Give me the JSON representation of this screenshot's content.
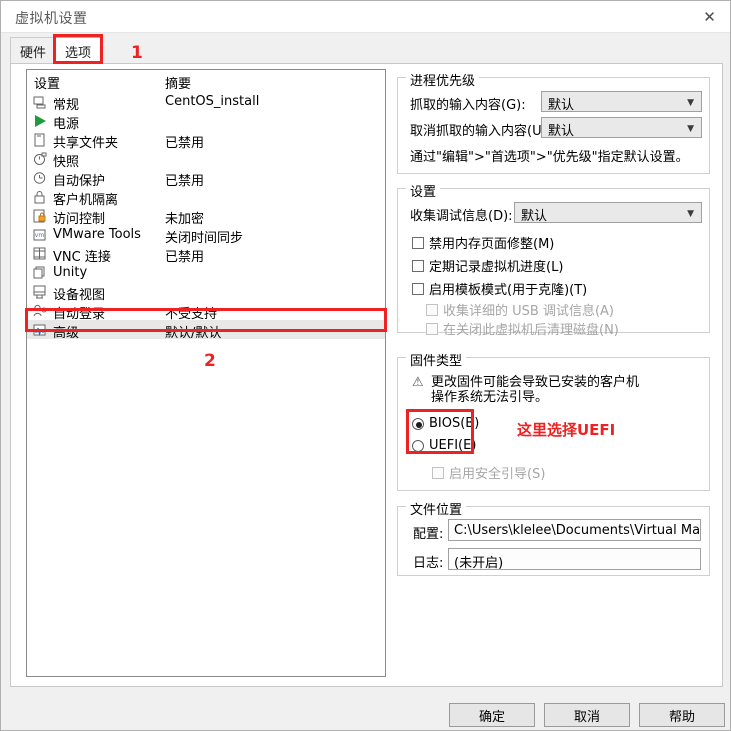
{
  "window": {
    "title": "虚拟机设置",
    "close_label": "✕"
  },
  "tabs": [
    {
      "label": "硬件",
      "active": false
    },
    {
      "label": "选项",
      "active": true
    }
  ],
  "settings_list": {
    "headers": {
      "name": "设置",
      "summary": "摘要"
    },
    "rows": [
      {
        "icon": "monitor-icon",
        "label": "常规",
        "summary": "CentOS_install",
        "selected": false
      },
      {
        "icon": "power-play-icon",
        "label": "电源",
        "summary": "",
        "selected": false
      },
      {
        "icon": "folder-share-icon",
        "label": "共享文件夹",
        "summary": "已禁用",
        "selected": false
      },
      {
        "icon": "camera-icon",
        "label": "快照",
        "summary": "",
        "selected": false
      },
      {
        "icon": "clock-icon",
        "label": "自动保护",
        "summary": "已禁用",
        "selected": false
      },
      {
        "icon": "lock-icon",
        "label": "客户机隔离",
        "summary": "",
        "selected": false
      },
      {
        "icon": "access-lock-icon",
        "label": "访问控制",
        "summary": "未加密",
        "selected": false
      },
      {
        "icon": "vmware-tools-icon",
        "label": "VMware Tools",
        "summary": "关闭时间同步",
        "selected": false
      },
      {
        "icon": "vnc-icon",
        "label": "VNC 连接",
        "summary": "已禁用",
        "selected": false
      },
      {
        "icon": "unity-icon",
        "label": "Unity",
        "summary": "",
        "selected": false
      },
      {
        "icon": "device-view-icon",
        "label": "设备视图",
        "summary": "",
        "selected": false
      },
      {
        "icon": "user-auto-icon",
        "label": "自动登录",
        "summary": "不受支持",
        "selected": false
      },
      {
        "icon": "advanced-icon",
        "label": "高级",
        "summary": "默认/默认",
        "selected": true
      }
    ]
  },
  "priority_group": {
    "legend": "进程优先级",
    "grab_label": "抓取的输入内容(G):",
    "grab_value": "默认",
    "ungrab_label": "取消抓取的输入内容(U):",
    "ungrab_value": "默认",
    "hint": "通过\"编辑\">\"首选项\">\"优先级\"指定默认设置。"
  },
  "settings_group": {
    "legend": "设置",
    "debug_label": "收集调试信息(D):",
    "debug_value": "默认",
    "checkboxes": [
      {
        "label": "禁用内存页面修整(M)",
        "checked": false,
        "disabled": false
      },
      {
        "label": "定期记录虚拟机进度(L)",
        "checked": false,
        "disabled": false
      },
      {
        "label": "启用模板模式(用于克隆)(T)",
        "checked": false,
        "disabled": false
      },
      {
        "label": "收集详细的 USB 调试信息(A)",
        "checked": false,
        "disabled": true
      },
      {
        "label": "在关闭此虚拟机后清理磁盘(N)",
        "checked": false,
        "disabled": true
      }
    ]
  },
  "firmware_group": {
    "legend": "固件类型",
    "warning_icon": "⚠",
    "warning_line1": "更改固件可能会导致已安装的客户机",
    "warning_line2": "操作系统无法引导。",
    "radios": [
      {
        "label": "BIOS(B)",
        "checked": true
      },
      {
        "label": "UEFI(E)",
        "checked": false
      }
    ],
    "secure_boot": {
      "label": "启用安全引导(S)",
      "checked": false,
      "disabled": true
    }
  },
  "files_group": {
    "legend": "文件位置",
    "config_label": "配置:",
    "config_value": "C:\\Users\\klelee\\Documents\\Virtual Machines\\",
    "log_label": "日志:",
    "log_value": "(未开启)"
  },
  "buttons": {
    "ok": "确定",
    "cancel": "取消",
    "help": "帮助"
  },
  "annotations": {
    "number_one": "1",
    "number_two": "2",
    "uefi_note": "这里选择UEFI",
    "color": "#ee2222"
  }
}
